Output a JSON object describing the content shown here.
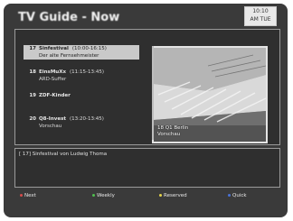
{
  "header": {
    "title": "TV Guide - Now",
    "clock_line1": "10:10",
    "clock_line2": "AM TUE"
  },
  "channels": [
    {
      "number": "17",
      "name": "Sinfestival",
      "time": "(10:00-16:15)",
      "subtitle": "Der alte Fernsehmeister",
      "selected": true
    },
    {
      "number": "18",
      "name": "EinsMuXx",
      "time": "(11:15-13:45)",
      "subtitle": "ARD-Suffer",
      "selected": false
    },
    {
      "number": "19",
      "name": "ZDF-Kinder",
      "time": "",
      "subtitle": "",
      "selected": false
    },
    {
      "number": "20",
      "name": "Q8-Invest",
      "time": "(13:20-13:45)",
      "subtitle": "Vorschau",
      "selected": false
    }
  ],
  "preview": {
    "caption_line1": "18 Q1 Berlin",
    "caption_line2": "Vorschau"
  },
  "info": {
    "text": "[ 17] Sinfestival von Ludwig Thoma"
  },
  "keys": [
    {
      "label": "Next",
      "color": "#d84b4b"
    },
    {
      "label": "Weekly",
      "color": "#4fbf4f"
    },
    {
      "label": "Reserved",
      "color": "#e3d24a"
    },
    {
      "label": "Quick",
      "color": "#4a72d8"
    }
  ]
}
